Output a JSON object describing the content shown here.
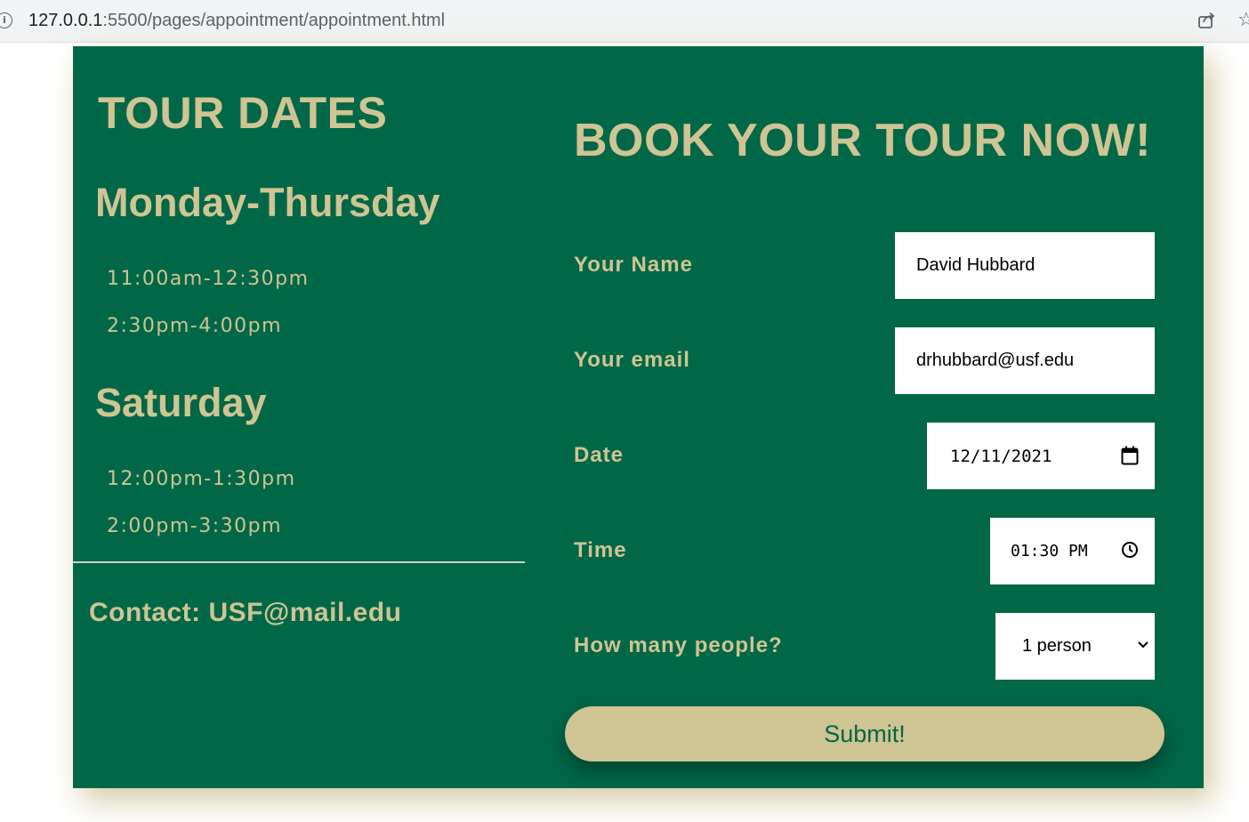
{
  "browser": {
    "url_host": "127.0.0.1",
    "url_rest": ":5500/pages/appointment/appointment.html"
  },
  "tour_dates": {
    "title": "TOUR DATES",
    "groups": [
      {
        "day": "Monday-Thursday",
        "slots": [
          "11:00am-12:30pm",
          "2:30pm-4:00pm"
        ]
      },
      {
        "day": "Saturday",
        "slots": [
          "12:00pm-1:30pm",
          "2:00pm-3:30pm"
        ]
      }
    ],
    "contact": "Contact: USF@mail.edu"
  },
  "booking": {
    "title": "BOOK YOUR TOUR NOW!",
    "name_label": "Your Name",
    "name_value": "David Hubbard",
    "email_label": "Your email",
    "email_value": "drhubbard@usf.edu",
    "date_label": "Date",
    "date_value": "12/11/2021",
    "time_label": "Time",
    "time_value": "01:30 PM",
    "people_label": "How many people?",
    "people_value": "1 person",
    "submit_label": "Submit!"
  },
  "colors": {
    "background": "#006747",
    "accent": "#cfc493"
  }
}
